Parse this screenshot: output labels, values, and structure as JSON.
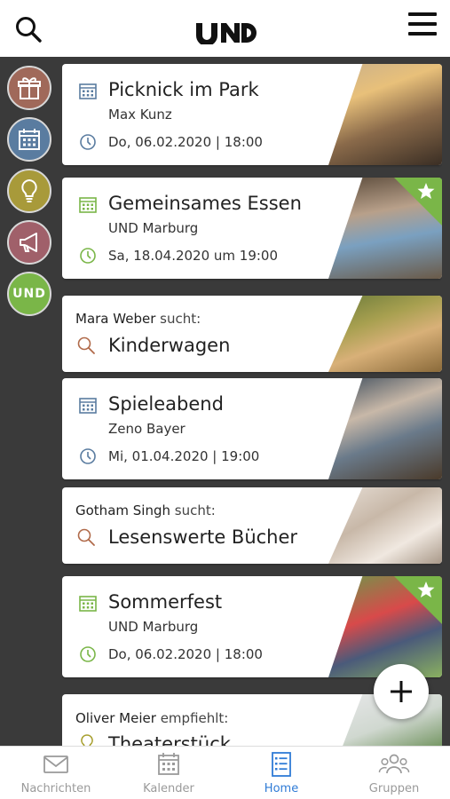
{
  "header": {
    "logo_text": "UND",
    "search_icon": "search-icon",
    "menu_icon": "hamburger-menu-icon"
  },
  "rail": {
    "items": [
      {
        "name": "gift",
        "icon": "gift-icon",
        "color": "#a0695a"
      },
      {
        "name": "calendar",
        "icon": "calendar-icon",
        "color": "#5a7ca0"
      },
      {
        "name": "ideas",
        "icon": "lightbulb-icon",
        "color": "#a89a3a"
      },
      {
        "name": "announcements",
        "icon": "megaphone-icon",
        "color": "#a0606a"
      },
      {
        "name": "und",
        "icon": "und-logo-icon",
        "color": "#7ab648",
        "label": "UND"
      }
    ]
  },
  "feed": {
    "cards": [
      {
        "type": "event",
        "title": "Picknick im Park",
        "organizer": "Max Kunz",
        "datetime": "Do, 06.02.2020 | 18:00",
        "accent": "#5a7ca0",
        "featured": false
      },
      {
        "type": "event",
        "title": "Gemeinsames Essen",
        "organizer": "UND Marburg",
        "datetime": "Sa, 18.04.2020 um 19:00",
        "accent": "#7ab648",
        "featured": true
      },
      {
        "type": "search",
        "user": "Mara Weber",
        "verb": "sucht:",
        "title": "Kinderwagen",
        "accent": "#b06a4a"
      },
      {
        "type": "event",
        "title": "Spieleabend",
        "organizer": "Zeno Bayer",
        "datetime": "Mi, 01.04.2020 | 19:00",
        "accent": "#5a7ca0",
        "featured": false
      },
      {
        "type": "search",
        "user": "Gotham Singh",
        "verb": "sucht:",
        "title": "Lesenswerte Bücher",
        "accent": "#b06a4a"
      },
      {
        "type": "event",
        "title": "Sommerfest",
        "organizer": "UND Marburg",
        "datetime": "Do, 06.02.2020 | 18:00",
        "accent": "#7ab648",
        "featured": true
      },
      {
        "type": "recommend",
        "user": "Oliver Meier",
        "verb": "empfiehlt:",
        "title": "Theaterstück",
        "accent": "#a8a030"
      }
    ]
  },
  "fab": {
    "icon": "plus-icon"
  },
  "bottom_nav": {
    "tabs": [
      {
        "label": "Nachrichten",
        "icon": "mail-icon",
        "active": false
      },
      {
        "label": "Kalender",
        "icon": "calendar-icon",
        "active": false
      },
      {
        "label": "Home",
        "icon": "list-icon",
        "active": true
      },
      {
        "label": "Gruppen",
        "icon": "group-icon",
        "active": false
      }
    ],
    "active_color": "#2f7bd6"
  }
}
